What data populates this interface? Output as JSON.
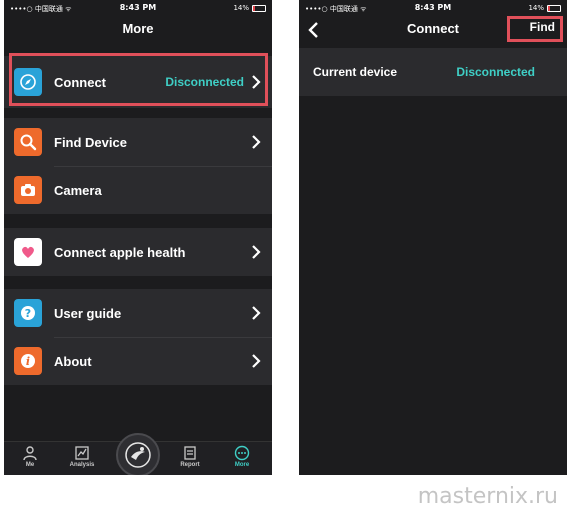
{
  "status_bar": {
    "carrier": "••••○ 中国联通 ᯤ",
    "time": "8:43 PM",
    "battery": "14%",
    "battery_level": 0.14
  },
  "more_screen": {
    "title": "More",
    "connect": {
      "label": "Connect",
      "status": "Disconnected"
    },
    "find_device": {
      "label": "Find Device"
    },
    "camera": {
      "label": "Camera"
    },
    "apple_health": {
      "label": "Connect apple health"
    },
    "user_guide": {
      "label": "User guide"
    },
    "about": {
      "label": "About"
    },
    "tabs": [
      {
        "label": "Me",
        "icon": "person-icon"
      },
      {
        "label": "Analysis",
        "icon": "chart-icon"
      },
      {
        "label": "",
        "icon": "runner-icon"
      },
      {
        "label": "Report",
        "icon": "report-icon"
      },
      {
        "label": "More",
        "icon": "more-dots-icon"
      }
    ],
    "active_tab": "More"
  },
  "connect_screen": {
    "title": "Connect",
    "find_label": "Find",
    "current_device_label": "Current device",
    "current_device_status": "Disconnected"
  },
  "colors": {
    "background": "#1c1c1e",
    "accent_teal": "#3fcfc6",
    "highlight_red": "#e0505a",
    "icon_blue": "#2aa3d8",
    "icon_orange": "#ee6a2c"
  },
  "watermark": "masternix.ru"
}
